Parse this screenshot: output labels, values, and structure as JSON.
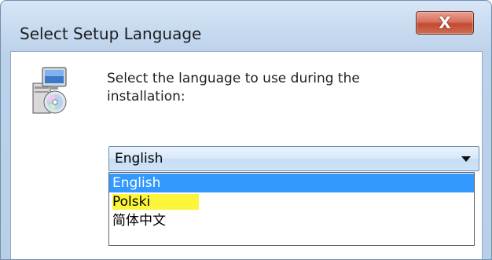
{
  "window": {
    "title": "Select Setup Language",
    "close_label": "X"
  },
  "prompt": {
    "text": "Select the language to use during the installation:"
  },
  "language_select": {
    "selected_value": "English",
    "options": [
      "English",
      "Polski",
      "简体中文"
    ]
  },
  "icons": {
    "setup": "setup-computer-disc-icon",
    "close": "close-icon",
    "dropdown": "chevron-down-icon"
  },
  "colors": {
    "selected_option_bg": "#3399ff",
    "highlight_marker": "#fcf53a",
    "close_button": "#c24a32"
  }
}
